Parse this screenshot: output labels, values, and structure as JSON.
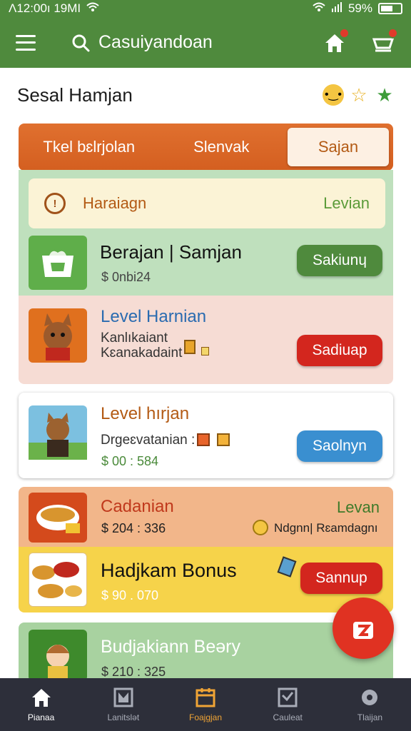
{
  "status": {
    "time": "Λ12:00ı 19MI",
    "battery": "59%"
  },
  "appbar": {
    "search_text": "Casuiyandoan"
  },
  "section": {
    "title": "Sesal Hamjan"
  },
  "tabs": [
    {
      "label": "Tkel bɛlrjolan"
    },
    {
      "label": "Slenvak"
    },
    {
      "label": "Sajan"
    }
  ],
  "alert": {
    "text": "Haraiagn",
    "link": "Levian"
  },
  "cards": [
    {
      "title": "Berajan | Samjan",
      "price": "$ 0nbi24",
      "button": "Sakiunɥ"
    },
    {
      "title": "Level Harnian",
      "line1": "Kanlıkaiant",
      "line2": "Kɛanakadaint",
      "button": "Sadiuap"
    },
    {
      "title": "Level hırjan",
      "line1": "Drgeɛvatanian :",
      "price": "$ 00 : 584",
      "button": "Saolnyn"
    },
    {
      "title": "Cadanian",
      "price": "$ 204 : 336",
      "right_label": "Levan",
      "right_text": "Ndgnn| Rɛamdagnı"
    },
    {
      "title": "Hadjkam Bonus",
      "price": "$ 90 . 070",
      "button": "Sannup"
    },
    {
      "title": "Budjakiann Beəry",
      "price": "$ 210 : 325"
    }
  ],
  "nav": [
    {
      "label": "Pianaa"
    },
    {
      "label": "Lanitslət"
    },
    {
      "label": "Foajgjan"
    },
    {
      "label": "Cauleat"
    },
    {
      "label": "Tlaijan"
    }
  ],
  "colors": {
    "brand": "#4f8a3d",
    "accent": "#e0702f",
    "fab": "#e03222"
  }
}
